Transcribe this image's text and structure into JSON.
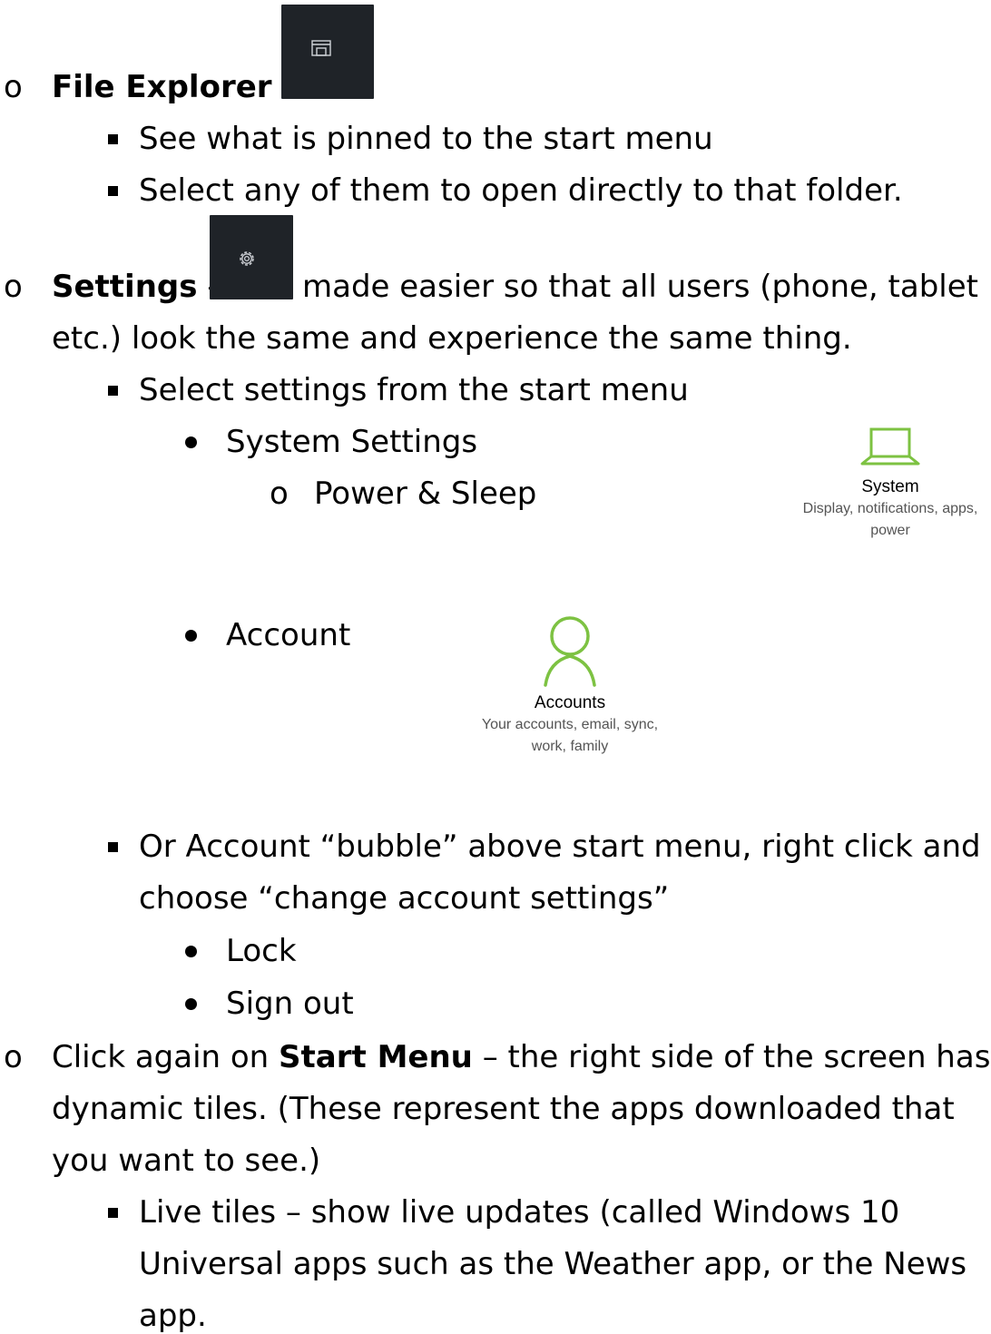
{
  "file_explorer": {
    "bullet": "o",
    "title": "File Explorer",
    "dash": " - ",
    "icon": "folder-icon",
    "sub_items": [
      " See what is pinned to the start menu",
      "Select any of them to open directly to that folder."
    ]
  },
  "settings": {
    "bullet": "o",
    "title": "Settings",
    "dash": " - ",
    "icon": "gear-icon",
    "desc_1": "made easier so that all users (phone, tablet",
    "desc_2": "etc.) look the same and experience the same thing.",
    "select_item": "Select settings from the start menu",
    "system_settings": "System Settings",
    "power_bullet": "o",
    "power_sleep": "Power & Sleep",
    "system_card": {
      "icon": "laptop-icon",
      "title": "System",
      "subtitle_1": "Display, notifications, apps,",
      "subtitle_2": "power",
      "icon_color": "#7dc242"
    },
    "account": "Account",
    "accounts_card": {
      "icon": "person-icon",
      "title": "Accounts",
      "subtitle_1": "Your accounts, email, sync,",
      "subtitle_2": "work, family",
      "icon_color": "#7dc242"
    },
    "bubble_1": "Or Account “bubble” above start menu, right click and",
    "bubble_2": "choose “change account settings”",
    "lock": "Lock",
    "sign_out": "Sign out"
  },
  "start_menu": {
    "bullet": "o",
    "prefix": "Click again on ",
    "bold": "Start Menu",
    "rest": " – the right side of the screen has",
    "line_2": "dynamic tiles. (These represent the apps downloaded that",
    "line_3": "you want to see.)",
    "live_1": "Live tiles – show live updates (called Windows 10",
    "live_2": "Universal apps such as the Weather app, or the News",
    "live_3": "app."
  }
}
